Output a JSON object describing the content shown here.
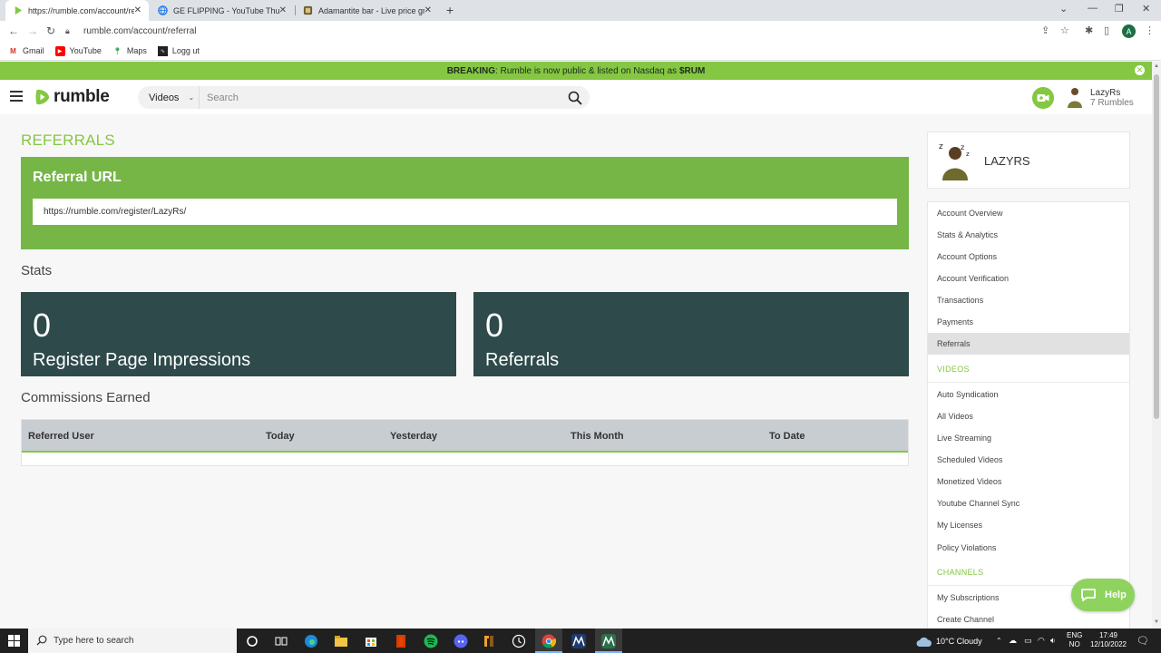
{
  "browser": {
    "tabs": [
      {
        "title": "https://rumble.com/account/refe",
        "active": true
      },
      {
        "title": "GE FLIPPING - YouTube Thumbn",
        "active": false
      },
      {
        "title": "Adamantite bar - Live price grap",
        "active": false
      }
    ],
    "url": "rumble.com/account/referral",
    "profile_initial": "A",
    "bookmarks": [
      "Gmail",
      "YouTube",
      "Maps",
      "Logg ut"
    ]
  },
  "breaking": {
    "label": "BREAKING",
    "text": ": Rumble is now public & listed on Nasdaq as ",
    "ticker": "$RUM"
  },
  "header": {
    "logo_text": "rumble",
    "search_category": "Videos",
    "search_placeholder": "Search",
    "user_name": "LazyRs",
    "user_rumbles": "7 Rumbles"
  },
  "main": {
    "page_title": "REFERRALS",
    "referral_url_label": "Referral URL",
    "referral_url": "https://rumble.com/register/LazyRs/",
    "stats_heading": "Stats",
    "stats": [
      {
        "value": "0",
        "label": "Register Page Impressions"
      },
      {
        "value": "0",
        "label": "Referrals"
      }
    ],
    "commissions_heading": "Commissions Earned",
    "commissions_columns": [
      "Referred User",
      "Today",
      "Yesterday",
      "This Month",
      "To Date"
    ]
  },
  "sidebar": {
    "profile_name": "LAZYRS",
    "account_items": [
      "Account Overview",
      "Stats & Analytics",
      "Account Options",
      "Account Verification",
      "Transactions",
      "Payments",
      "Referrals"
    ],
    "videos_heading": "VIDEOS",
    "videos_items": [
      "Auto Syndication",
      "All Videos",
      "Live Streaming",
      "Scheduled Videos",
      "Monetized Videos",
      "Youtube Channel Sync",
      "My Licenses",
      "Policy Violations"
    ],
    "channels_heading": "CHANNELS",
    "channels_items": [
      "My Subscriptions",
      "Create Channel"
    ]
  },
  "help_label": "Help",
  "taskbar": {
    "search_placeholder": "Type here to search",
    "weather": "10°C  Cloudy",
    "lang_top": "ENG",
    "lang_bottom": "NO",
    "time": "17:49",
    "date": "12/10/2022"
  },
  "colors": {
    "brand_green": "#85c742",
    "panel_green": "#75b646",
    "stat_card": "#2e4a4a"
  }
}
